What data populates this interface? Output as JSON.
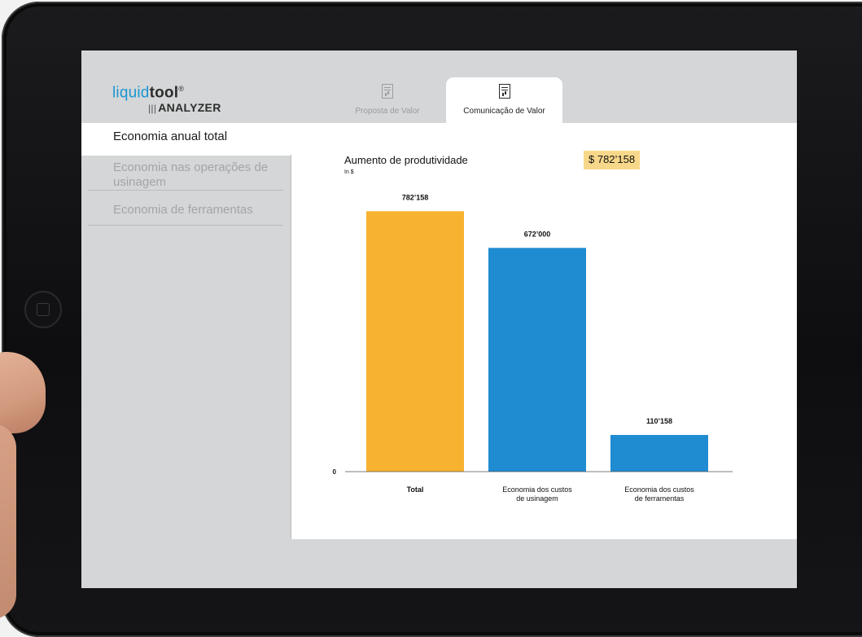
{
  "app": {
    "logo": {
      "liquid": "liquid",
      "tool": "tool",
      "reg": "®",
      "analyzer": "ANALYZER",
      "bars": "|||"
    }
  },
  "tabs": [
    {
      "label": "Proposta de Valor",
      "icon": "document-chart-icon",
      "active": false
    },
    {
      "label": "Comunicação de Valor",
      "icon": "document-chart-icon",
      "active": true
    }
  ],
  "sidebar": {
    "items": [
      {
        "label": "Economia anual total",
        "active": true
      },
      {
        "label": "Economia nas operações de usinagem",
        "active": false
      },
      {
        "label": "Economia de ferramentas",
        "active": false
      }
    ]
  },
  "chart_header": {
    "title": "Aumento de produtividade",
    "unit": "In $",
    "total_badge": "$ 782’158"
  },
  "colors": {
    "brand_blue": "#1b96d3",
    "bar_orange": "#f7b230",
    "bar_blue": "#1f8bd1",
    "badge": "#f7d88a"
  },
  "chart_data": {
    "type": "bar",
    "title": "Aumento de produtividade",
    "ylabel": "In $",
    "ylim": [
      0,
      800000
    ],
    "y_ticks": [
      {
        "value": 0,
        "label": "0"
      }
    ],
    "categories": [
      "Total",
      "Economia dos custos de usinagem",
      "Economia dos custos de ferramentas"
    ],
    "values": [
      782158,
      672000,
      110158
    ],
    "value_labels": [
      "782’158",
      "672’000",
      "110’158"
    ],
    "bar_colors": [
      "#f7b230",
      "#1f8bd1",
      "#1f8bd1"
    ],
    "grid": false
  }
}
